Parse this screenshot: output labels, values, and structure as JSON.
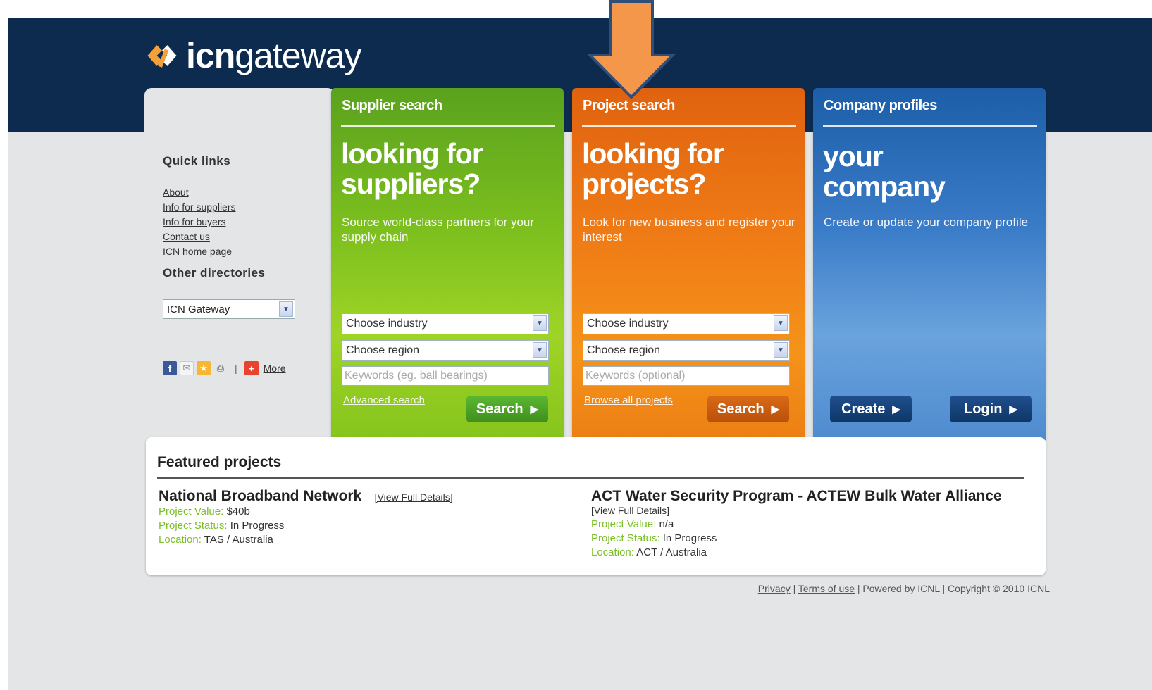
{
  "brand": {
    "logo_bold": "icn",
    "logo_light": "gateway"
  },
  "left_panel": {
    "quick_links_heading": "Quick links",
    "quick_links": [
      "About",
      "Info for suppliers",
      "Info for buyers",
      "Contact us",
      "ICN home page"
    ],
    "other_directories_heading": "Other directories",
    "directory_selected": "ICN Gateway",
    "share_separator": "|",
    "share_more": "More"
  },
  "supplier_card": {
    "title": "Supplier search",
    "headline": "looking for\nsuppliers?",
    "description": "Source world-class partners for your supply chain",
    "industry_select": "Choose industry",
    "region_select": "Choose region",
    "keywords_placeholder": "Keywords (eg. ball bearings)",
    "link": "Advanced search",
    "button": "Search"
  },
  "project_card": {
    "title": "Project search",
    "headline": "looking for\nprojects?",
    "description": "Look for new business and register your interest",
    "industry_select": "Choose industry",
    "region_select": "Choose region",
    "keywords_placeholder": "Keywords (optional)",
    "link": "Browse all projects",
    "button": "Search"
  },
  "company_card": {
    "title": "Company profiles",
    "headline": "your\ncompany",
    "description": "Create or update your company profile",
    "create_button": "Create",
    "login_button": "Login"
  },
  "featured": {
    "title": "Featured projects",
    "projects": [
      {
        "name": "National Broadband Network",
        "link": "[View Full Details]",
        "value_label": "Project Value:",
        "value": "$40b",
        "status_label": "Project Status:",
        "status": "In Progress",
        "location_label": "Location:",
        "location": "TAS / Australia"
      },
      {
        "name": "ACT Water Security Program - ACTEW Bulk Water Alliance",
        "link": "[View Full Details]",
        "value_label": "Project Value:",
        "value": "n/a",
        "status_label": "Project Status:",
        "status": "In Progress",
        "location_label": "Location:",
        "location": "ACT / Australia"
      }
    ]
  },
  "footer": {
    "privacy": "Privacy",
    "sep1": " | ",
    "terms": "Terms of use",
    "rest": " | Powered by ICNL | Copyright © 2010 ICNL"
  },
  "colors": {
    "header": "#0d2b4e",
    "supplier": "#7cbf1e",
    "project": "#f07d16",
    "company": "#3a7cc8",
    "arrow": "#f5974a",
    "label_green": "#7bbf27"
  },
  "icons": [
    "facebook-icon",
    "email-icon",
    "favorite-icon",
    "print-icon",
    "addthis-plus-icon",
    "chevron-down-icon",
    "caret-right-icon"
  ]
}
